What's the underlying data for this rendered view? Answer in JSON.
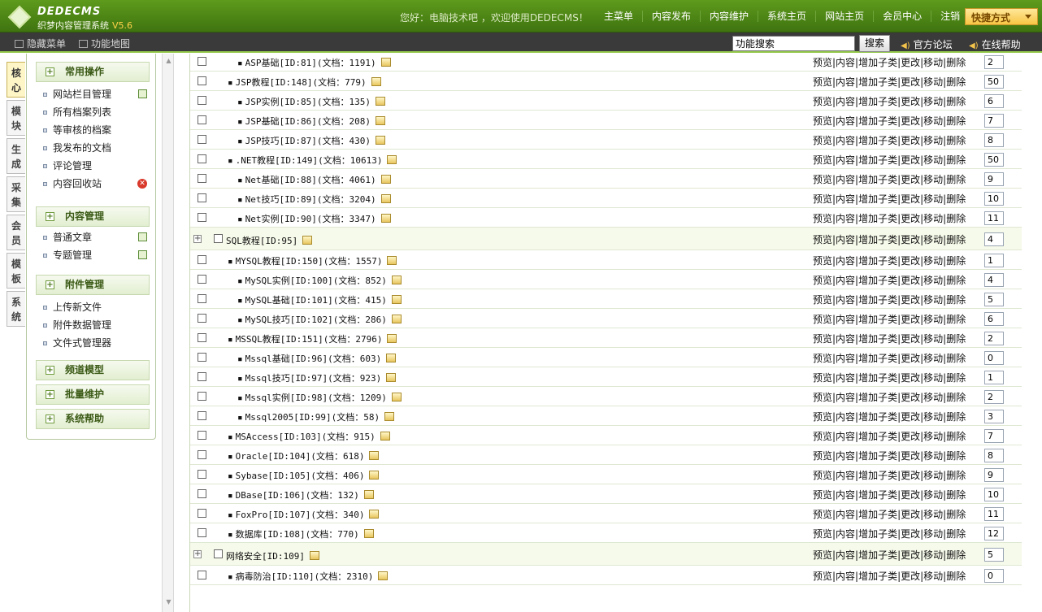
{
  "header": {
    "brand": "DEDECMS",
    "subtitle": "织梦内容管理系统",
    "version": "V5.6",
    "welcome": "您好：电脑技术吧 ，欢迎使用DEDECMS！",
    "nav": [
      "主菜单",
      "内容发布",
      "内容维护",
      "系统主页",
      "网站主页",
      "会员中心",
      "注销"
    ],
    "quick": "快捷方式"
  },
  "toolbar": {
    "hide_menu": "隐藏菜单",
    "site_map": "功能地图",
    "search_value": "功能搜索",
    "search_button": "搜索",
    "forum": "官方论坛",
    "help": "在线帮助"
  },
  "side_tabs": [
    "核心",
    "模块",
    "生成",
    "采集",
    "会员",
    "模板",
    "系统"
  ],
  "menu": {
    "groups": [
      {
        "title": "常用操作",
        "items": [
          "网站栏目管理",
          "所有档案列表",
          "等审核的档案",
          "我发布的文档",
          "评论管理",
          "内容回收站"
        ]
      },
      {
        "title": "内容管理",
        "items": [
          "普通文章",
          "专题管理"
        ]
      },
      {
        "title": "附件管理",
        "items": [
          "上传新文件",
          "附件数据管理",
          "文件式管理器"
        ]
      },
      {
        "title": "频道模型",
        "items": []
      },
      {
        "title": "批量维护",
        "items": []
      },
      {
        "title": "系统帮助",
        "items": []
      }
    ]
  },
  "ops": "预览|内容|增加子类|更改|移动|删除",
  "rows": [
    {
      "level": 2,
      "text": "ASP基础[ID:81](文档：1191)",
      "rank": "2"
    },
    {
      "level": 1,
      "text": "JSP教程[ID:148](文档：779)",
      "rank": "50"
    },
    {
      "level": 2,
      "text": "JSP实例[ID:85](文档：135)",
      "rank": "6"
    },
    {
      "level": 2,
      "text": "JSP基础[ID:86](文档：208)",
      "rank": "7"
    },
    {
      "level": 2,
      "text": "JSP技巧[ID:87](文档：430)",
      "rank": "8"
    },
    {
      "level": 1,
      "text": ".NET教程[ID:149](文档：10613)",
      "rank": "50"
    },
    {
      "level": 2,
      "text": "Net基础[ID:88](文档：4061)",
      "rank": "9"
    },
    {
      "level": 2,
      "text": "Net技巧[ID:89](文档：3204)",
      "rank": "10"
    },
    {
      "level": 2,
      "text": "Net实例[ID:90](文档：3347)",
      "rank": "11"
    },
    {
      "level": 0,
      "text": "SQL教程[ID:95]",
      "rank": "4"
    },
    {
      "level": 1,
      "text": "MYSQL教程[ID:150](文档：1557)",
      "rank": "1"
    },
    {
      "level": 2,
      "text": "MySQL实例[ID:100](文档：852)",
      "rank": "4"
    },
    {
      "level": 2,
      "text": "MySQL基础[ID:101](文档：415)",
      "rank": "5"
    },
    {
      "level": 2,
      "text": "MySQL技巧[ID:102](文档：286)",
      "rank": "6"
    },
    {
      "level": 1,
      "text": "MSSQL教程[ID:151](文档：2796)",
      "rank": "2"
    },
    {
      "level": 2,
      "text": "Mssql基础[ID:96](文档：603)",
      "rank": "0"
    },
    {
      "level": 2,
      "text": "Mssql技巧[ID:97](文档：923)",
      "rank": "1"
    },
    {
      "level": 2,
      "text": "Mssql实例[ID:98](文档：1209)",
      "rank": "2"
    },
    {
      "level": 2,
      "text": "Mssql2005[ID:99](文档：58)",
      "rank": "3"
    },
    {
      "level": 1,
      "text": "MSAccess[ID:103](文档：915)",
      "rank": "7"
    },
    {
      "level": 1,
      "text": "Oracle[ID:104](文档：618)",
      "rank": "8"
    },
    {
      "level": 1,
      "text": "Sybase[ID:105](文档：406)",
      "rank": "9"
    },
    {
      "level": 1,
      "text": "DBase[ID:106](文档：132)",
      "rank": "10"
    },
    {
      "level": 1,
      "text": "FoxPro[ID:107](文档：340)",
      "rank": "11"
    },
    {
      "level": 1,
      "text": "数据库[ID:108](文档：770)",
      "rank": "12"
    },
    {
      "level": 0,
      "text": "网络安全[ID:109]",
      "rank": "5"
    },
    {
      "level": 1,
      "text": "病毒防治[ID:110](文档：2310)",
      "rank": "0"
    }
  ]
}
